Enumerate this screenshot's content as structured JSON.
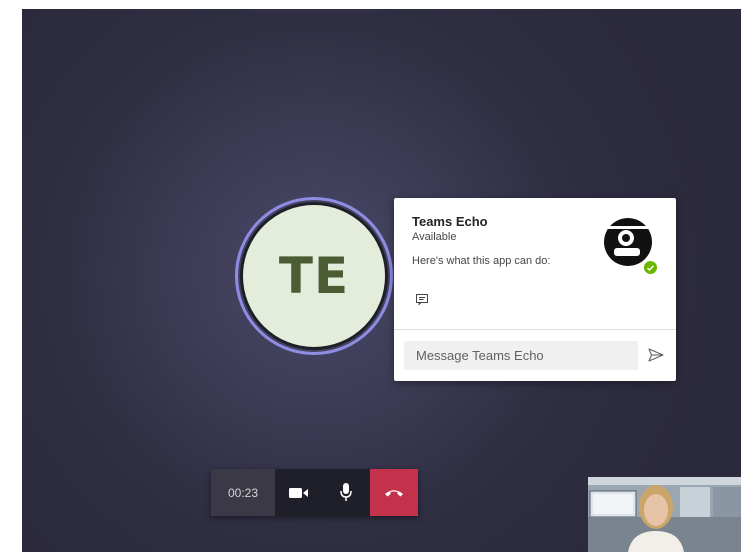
{
  "call": {
    "avatar_initials": "TE",
    "timer": "00:23"
  },
  "card": {
    "title": "Teams Echo",
    "status": "Available",
    "description": "Here's what this app can do:",
    "message_placeholder": "Message Teams Echo",
    "presence_color": "#6bb700"
  },
  "controls": {
    "camera_icon": "video-camera-icon",
    "mic_icon": "microphone-icon",
    "hangup_icon": "hang-up-icon",
    "hangup_color": "#c4314b"
  },
  "self_view": {
    "icon": "self-video-preview"
  }
}
